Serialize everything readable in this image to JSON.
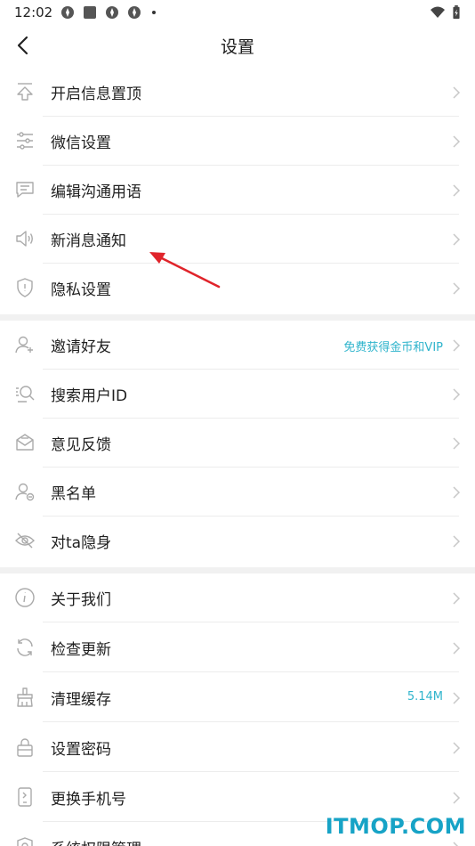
{
  "status_bar": {
    "time": "12:02"
  },
  "header": {
    "title": "设置"
  },
  "group1": [
    {
      "label": "开启信息置顶",
      "icon": "pin-top-icon"
    },
    {
      "label": "微信设置",
      "icon": "sliders-icon"
    },
    {
      "label": "编辑沟通用语",
      "icon": "message-icon"
    },
    {
      "label": "新消息通知",
      "icon": "speaker-icon"
    },
    {
      "label": "隐私设置",
      "icon": "shield-icon"
    }
  ],
  "group2": [
    {
      "label": "邀请好友",
      "icon": "user-add-icon",
      "value": "免费获得金币和VIP"
    },
    {
      "label": "搜索用户ID",
      "icon": "search-user-icon"
    },
    {
      "label": "意见反馈",
      "icon": "feedback-icon"
    },
    {
      "label": "黑名单",
      "icon": "user-block-icon"
    },
    {
      "label": "对ta隐身",
      "icon": "eye-off-icon"
    }
  ],
  "group3": [
    {
      "label": "关于我们",
      "icon": "info-icon"
    },
    {
      "label": "检查更新",
      "icon": "refresh-icon"
    },
    {
      "label": "清理缓存",
      "icon": "broom-icon",
      "value": "5.14M"
    },
    {
      "label": "设置密码",
      "icon": "lock-icon"
    },
    {
      "label": "更换手机号",
      "icon": "phone-icon"
    },
    {
      "label": "系统权限管理",
      "icon": "settings-icon"
    }
  ],
  "watermark": "ITMOP.COM",
  "colors": {
    "accent": "#2fb4cc",
    "watermark": "#17a3c6",
    "annotation_arrow": "#e0242b"
  }
}
